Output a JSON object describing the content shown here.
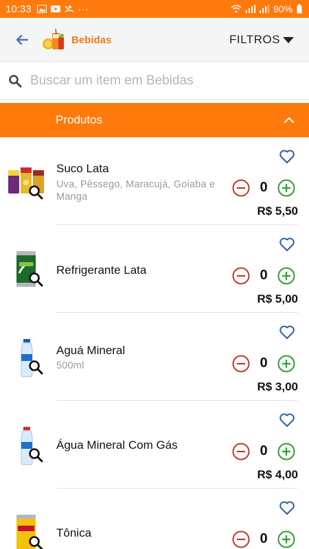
{
  "status_bar": {
    "time": "10:33",
    "dots": "···",
    "battery": "90%"
  },
  "header": {
    "category_title": "Bebidas",
    "filters_label": "FILTROS"
  },
  "search": {
    "placeholder": "Buscar um item em Bebidas",
    "value": ""
  },
  "section": {
    "title": "Produtos"
  },
  "products": [
    {
      "name": "Suco Lata",
      "description": "Uva, Pêssego, Maracujá, Goiaba e Manga",
      "quantity": "0",
      "price": "R$ 5,50",
      "favorite": false
    },
    {
      "name": "Refrigerante Lata",
      "description": "",
      "quantity": "0",
      "price": "R$ 5,00",
      "favorite": false
    },
    {
      "name": "Aguá Mineral",
      "description": "500ml",
      "quantity": "0",
      "price": "R$ 3,00",
      "favorite": false
    },
    {
      "name": "Água Mineral Com Gás",
      "description": "",
      "quantity": "0",
      "price": "R$ 4,00",
      "favorite": false
    },
    {
      "name": "Tônica",
      "description": "",
      "quantity": "0",
      "price": "",
      "favorite": false
    }
  ],
  "colors": {
    "brand_orange": "#ff7a0d",
    "title_orange": "#f07c1a",
    "minus_red": "#c0392b",
    "plus_green": "#2e9e2e",
    "heart_blue": "#2d5fa0"
  }
}
